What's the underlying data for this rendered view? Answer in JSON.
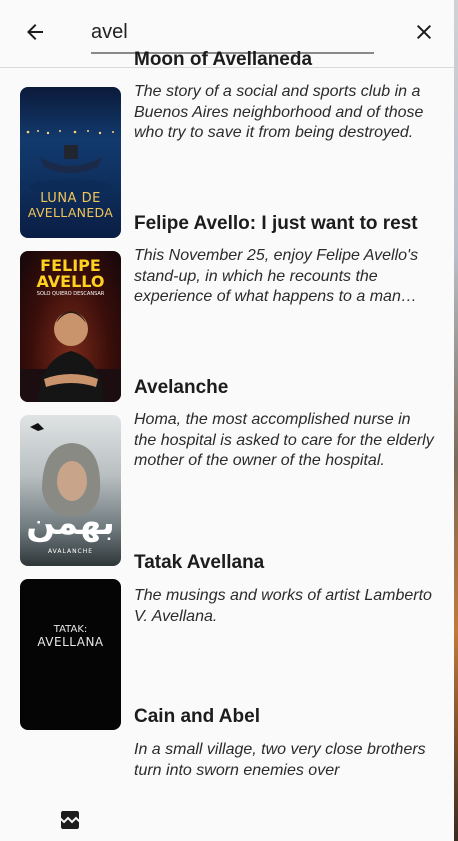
{
  "search": {
    "query": "avel",
    "back_icon": "arrow-left-icon",
    "clear_icon": "close-icon"
  },
  "results": [
    {
      "title": "Moon of Avellaneda",
      "description": "The story of a social and sports club in a Buenos Aires neighborhood and of those who try to save it from being destroyed.",
      "poster_text": "LUNA DE AVELLANEDA",
      "poster_line1": "LUNA DE",
      "poster_line2": "AVELLANEDA"
    },
    {
      "title": "Felipe Avello: I just want to rest",
      "description": "This November 25, enjoy Felipe Avello's stand-up, in which he recounts the experience of what happens to a man after years of marriage.",
      "poster_line1": "FELIPE",
      "poster_line2": "AVELLO",
      "poster_tagline": "SOLO QUIERO DESCANSAR"
    },
    {
      "title": "Avelanche",
      "description": "Homa, the most accomplished nurse in the hospital is asked to care for the elderly mother of the owner of the hospital.",
      "poster_line1": "بهمن",
      "poster_line2": "AVALANCHE"
    },
    {
      "title": "Tatak Avellana",
      "description": "The musings and works of artist Lamberto V. Avellana.",
      "poster_line1": "TATAK:",
      "poster_line2": "AVELLANA"
    },
    {
      "title": "Cain and Abel",
      "description": "In a small village, two very close brothers turn into sworn enemies over",
      "poster_icon": "broken-image-icon"
    }
  ]
}
